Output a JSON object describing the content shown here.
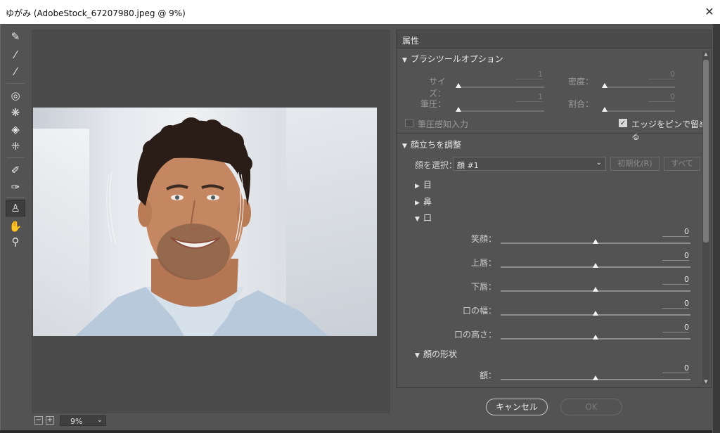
{
  "window": {
    "title": "ゆがみ (AdobeStock_67207980.jpeg @ 9%)",
    "close": "✕"
  },
  "toolbar": {
    "tools": [
      {
        "name": "forward-warp-tool",
        "glyph": "✎"
      },
      {
        "name": "reconstruct-tool",
        "glyph": "⁄"
      },
      {
        "name": "smooth-tool",
        "glyph": "⁄"
      },
      {
        "name": "twirl-tool",
        "glyph": "◎"
      },
      {
        "name": "pucker-tool",
        "glyph": "❋"
      },
      {
        "name": "bloat-tool",
        "glyph": "◈"
      },
      {
        "name": "push-left-tool",
        "glyph": "⁜"
      },
      {
        "name": "freeze-mask-tool",
        "glyph": "✐"
      },
      {
        "name": "thaw-mask-tool",
        "glyph": "✑"
      },
      {
        "name": "face-tool",
        "glyph": "♙"
      },
      {
        "name": "hand-tool",
        "glyph": "✋"
      },
      {
        "name": "zoom-tool",
        "glyph": "⚲"
      }
    ]
  },
  "zoom": {
    "minus": "−",
    "plus": "+",
    "value": "9%",
    "arrow": "⌄"
  },
  "panel": {
    "title": "属性",
    "brush": {
      "header": "ブラシツールオプション",
      "size_label": "サイズ：",
      "size_value": "1",
      "density_label": "密度：",
      "density_value": "0",
      "pressure_label": "筆圧：",
      "pressure_value": "1",
      "rate_label": "割合：",
      "rate_value": "0",
      "stylus_label": "筆圧感知入力",
      "pin_label": "エッジをピンで留める"
    },
    "face": {
      "header": "顔立ちを調整",
      "select_label": "顔を選択：",
      "select_value": "顔 #1",
      "reset_button": "初期化(R)",
      "all_button": "すべて",
      "eyes_label": "目",
      "nose_label": "鼻",
      "mouth_label": "口",
      "mouth_sliders": [
        {
          "label": "笑顔：",
          "value": "0"
        },
        {
          "label": "上唇：",
          "value": "0"
        },
        {
          "label": "下唇：",
          "value": "0"
        },
        {
          "label": "口の幅：",
          "value": "0"
        },
        {
          "label": "口の高さ：",
          "value": "0"
        }
      ],
      "shape_label": "顔の形状",
      "shape_sliders": [
        {
          "label": "額：",
          "value": "0"
        }
      ]
    }
  },
  "buttons": {
    "cancel": "キャンセル",
    "ok": "OK"
  }
}
